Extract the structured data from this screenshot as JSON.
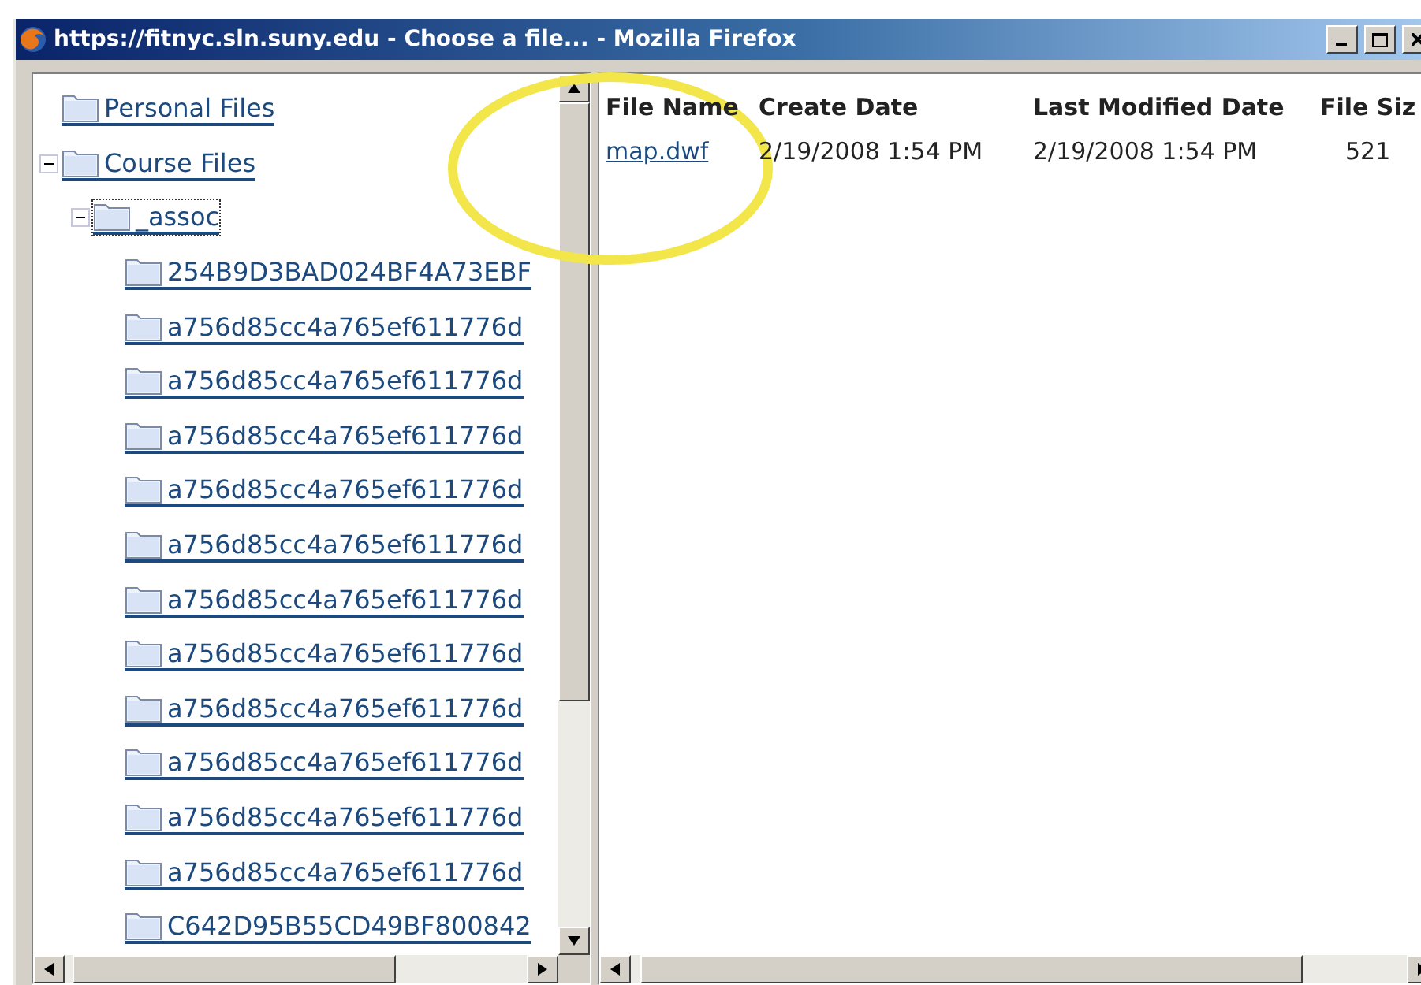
{
  "window": {
    "title": "https://fitnyc.sln.suny.edu - Choose a file... - Mozilla Firefox"
  },
  "tree": [
    {
      "label": "Personal Files",
      "selected": false
    },
    {
      "label": "Course Files",
      "expanded": true,
      "selected": false,
      "children": [
        {
          "label": "_assoc",
          "expanded": true,
          "selected": true,
          "children": [
            {
              "label": "254B9D3BAD024BF4A73EBF",
              "selected": false
            },
            {
              "label": "a756d85cc4a765ef611776d",
              "selected": false
            },
            {
              "label": "a756d85cc4a765ef611776d",
              "selected": false
            },
            {
              "label": "a756d85cc4a765ef611776d",
              "selected": false
            },
            {
              "label": "a756d85cc4a765ef611776d",
              "selected": false
            },
            {
              "label": "a756d85cc4a765ef611776d",
              "selected": false
            },
            {
              "label": "a756d85cc4a765ef611776d",
              "selected": false
            },
            {
              "label": "a756d85cc4a765ef611776d",
              "selected": false
            },
            {
              "label": "a756d85cc4a765ef611776d",
              "selected": false
            },
            {
              "label": "a756d85cc4a765ef611776d",
              "selected": false
            },
            {
              "label": "a756d85cc4a765ef611776d",
              "selected": false
            },
            {
              "label": "a756d85cc4a765ef611776d",
              "selected": false
            },
            {
              "label": "C642D95B55CD49BF800842",
              "selected": false
            }
          ]
        }
      ]
    }
  ],
  "table": {
    "columns": [
      "File Name",
      "Create Date",
      "Last Modified Date",
      "File Siz"
    ],
    "rows": [
      [
        "map.dwf",
        "2/19/2008 1:54 PM",
        "2/19/2008 1:54 PM",
        "521"
      ]
    ]
  }
}
